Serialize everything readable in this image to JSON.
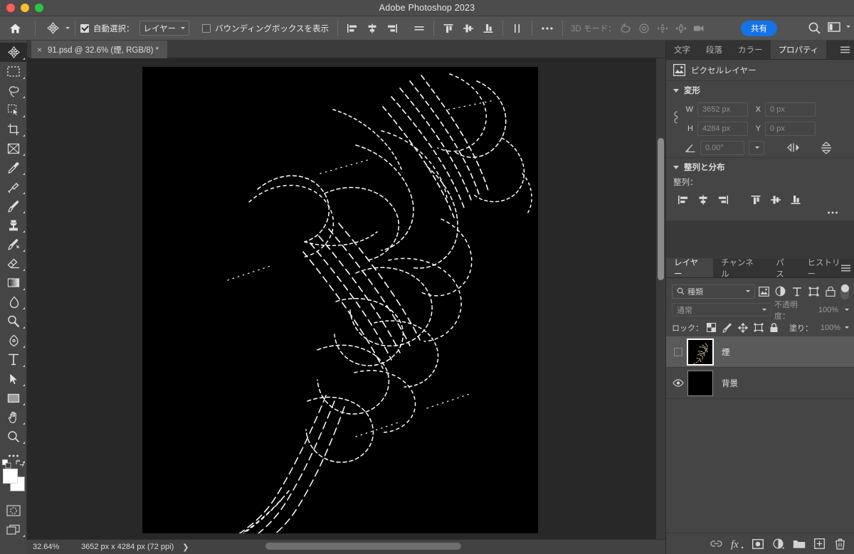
{
  "window": {
    "title": "Adobe Photoshop 2023",
    "traffic_lights": [
      "close",
      "minimize",
      "maximize"
    ],
    "accent_color": "#1473e6",
    "chrome_color": "#4c4c4c"
  },
  "options_bar": {
    "home_icon": "home-icon",
    "active_tool_icon": "move-tool-icon",
    "auto_select": {
      "label": "自動選択：",
      "checked": true
    },
    "auto_select_scope": "レイヤー",
    "show_bounding_box": {
      "label": "バウンディングボックスを表示",
      "checked": false
    },
    "align_icons": [
      "align-left-edges-icon",
      "align-horizontal-centers-icon",
      "align-right-edges-icon",
      "distribute-horizontal-icon"
    ],
    "align_icons_2": [
      "align-top-edges-icon",
      "align-vertical-centers-icon",
      "align-bottom-edges-icon"
    ],
    "align_icons_3": [
      "distribute-vertical-icon"
    ],
    "more_icon": "more-options-icon",
    "mode_3d_label": "3D モード：",
    "mode_3d_icons": [
      "rotate-3d-icon",
      "roll-3d-icon",
      "pan-3d-icon",
      "slide-3d-icon",
      "zoom-3d-camera-icon"
    ],
    "share_label": "共有",
    "search_icon": "search-icon",
    "workspace_icon": "workspace-switcher-icon",
    "workspace_caret": "chevron-down-icon"
  },
  "toolbar": {
    "tools": [
      {
        "name": "move-tool",
        "active": true
      },
      {
        "name": "rectangular-marquee-tool",
        "active": false
      },
      {
        "name": "lasso-tool",
        "active": false
      },
      {
        "name": "object-selection-tool",
        "active": false
      },
      {
        "name": "crop-tool",
        "active": false
      },
      {
        "name": "frame-tool",
        "active": false
      },
      {
        "name": "eyedropper-tool",
        "active": false
      },
      {
        "name": "spot-healing-brush-tool",
        "active": false
      },
      {
        "name": "brush-tool",
        "active": false
      },
      {
        "name": "clone-stamp-tool",
        "active": false
      },
      {
        "name": "history-brush-tool",
        "active": false
      },
      {
        "name": "eraser-tool",
        "active": false
      },
      {
        "name": "gradient-tool",
        "active": false
      },
      {
        "name": "blur-tool",
        "active": false
      },
      {
        "name": "dodge-tool",
        "active": false
      },
      {
        "name": "pen-tool",
        "active": false
      },
      {
        "name": "type-tool",
        "active": false
      },
      {
        "name": "path-selection-tool",
        "active": false
      },
      {
        "name": "rectangle-tool",
        "active": false
      },
      {
        "name": "hand-tool",
        "active": false
      },
      {
        "name": "zoom-tool",
        "active": false
      },
      {
        "name": "edit-toolbar-tool",
        "active": false
      }
    ],
    "foreground_color": "#ffffff",
    "background_color": "#ffffff",
    "quick_mask_icon": "quick-mask-icon",
    "screen_mode_icon": "screen-mode-icon"
  },
  "document": {
    "tab_label": "91.psd @ 32.6% (煙, RGB/8) *",
    "close_glyph": "×"
  },
  "status_bar": {
    "zoom": "32.64%",
    "dimensions": "3652 px x 4284 px (72 ppi)",
    "chevron": "❯"
  },
  "properties_panel": {
    "tabs": [
      {
        "label": "文字",
        "active": false
      },
      {
        "label": "段落",
        "active": false
      },
      {
        "label": "カラー",
        "active": false
      },
      {
        "label": "プロパティ",
        "active": true
      }
    ],
    "menu_icon": "panel-menu-icon",
    "layer_kind_icon": "pixel-layer-icon",
    "layer_kind": "ピクセルレイヤー",
    "transform": {
      "section_label": "変形",
      "link_icon": "link-aspect-ratio-icon",
      "w_label": "W",
      "w_value": "3652 px",
      "x_label": "X",
      "x_value": "0 px",
      "h_label": "H",
      "h_value": "4284 px",
      "y_label": "Y",
      "y_value": "0 px",
      "angle_icon": "angle-icon",
      "angle_value": "0.00°",
      "angle_caret": "chevron-down-icon",
      "flip_h_icon": "flip-horizontal-icon",
      "flip_v_icon": "flip-vertical-icon"
    },
    "align_distribute": {
      "section_label": "整列と分布",
      "align_label": "整列：",
      "icons": [
        "align-left-edges-icon",
        "align-horizontal-centers-icon",
        "align-right-edges-icon",
        "align-top-edges-icon",
        "align-vertical-centers-icon",
        "align-bottom-edges-icon"
      ],
      "more_icon": "more-options-icon"
    }
  },
  "layers_panel": {
    "tabs": [
      {
        "label": "レイヤー",
        "active": true
      },
      {
        "label": "チャンネル",
        "active": false
      },
      {
        "label": "パス",
        "active": false
      },
      {
        "label": "ヒストリー",
        "active": false
      }
    ],
    "menu_icon": "panel-menu-icon",
    "filter": {
      "search_icon": "search-icon",
      "value": "種類",
      "caret": "chevron-down-icon",
      "type_icons": [
        "filter-pixel-icon",
        "filter-adjustment-icon",
        "filter-type-icon",
        "filter-shape-icon",
        "filter-smart-object-icon"
      ],
      "toggle": "filter-enable-toggle"
    },
    "blend_mode": "通常",
    "opacity_label": "不透明度：",
    "opacity_value": "100%",
    "lock_label": "ロック：",
    "lock_icons": [
      "lock-transparent-pixels-icon",
      "lock-image-pixels-icon",
      "lock-position-icon",
      "lock-artboard-nesting-icon",
      "lock-all-icon"
    ],
    "fill_label": "塗り：",
    "fill_value": "100%",
    "layers": [
      {
        "name": "煙",
        "visible": false,
        "selected": true,
        "thumbnail": "smoke-sketch-thumbnail"
      },
      {
        "name": "背景",
        "visible": true,
        "selected": false,
        "thumbnail": "black-background-thumbnail"
      }
    ],
    "footer_icons": [
      "link-layers-icon",
      "layer-style-fx-icon",
      "add-layer-mask-icon",
      "new-adjustment-layer-icon",
      "new-group-icon",
      "new-layer-icon",
      "delete-layer-icon"
    ]
  },
  "canvas": {
    "background": "#000000",
    "artwork_description": "white dashed sketch-line smoke plume on black",
    "stroke_color": "#ffffff"
  }
}
